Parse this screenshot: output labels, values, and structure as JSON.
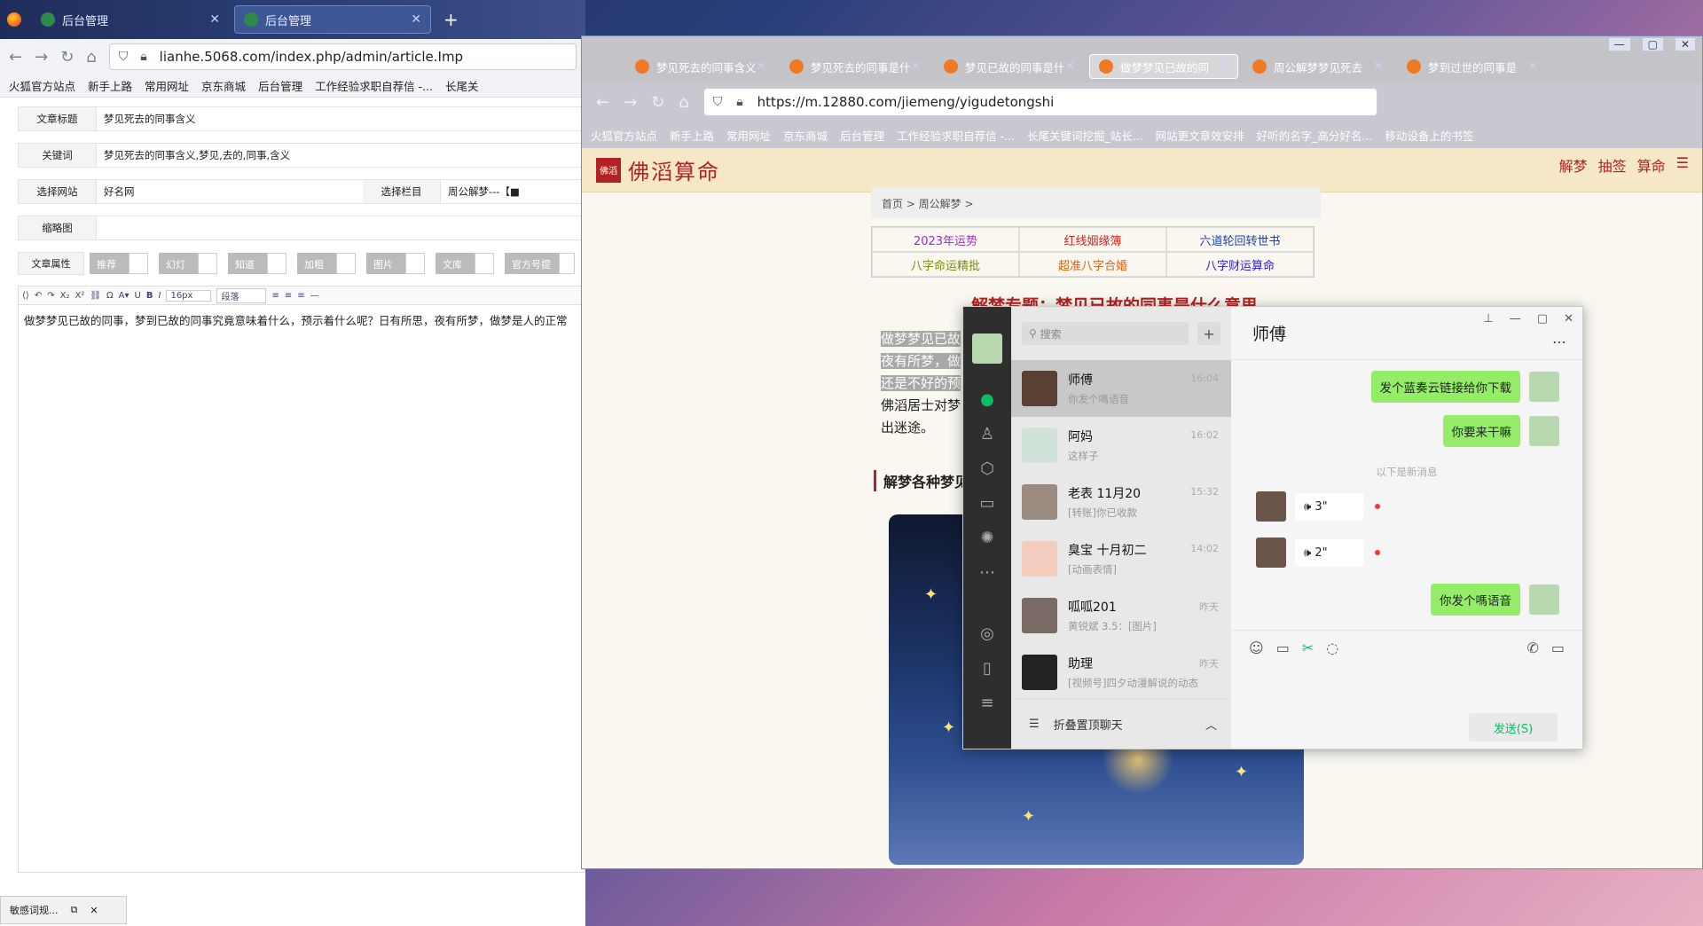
{
  "left_browser": {
    "tabs": [
      {
        "label": "后台管理",
        "close": "✕"
      },
      {
        "label": "后台管理",
        "close": "✕"
      }
    ],
    "new_tab": "+",
    "url": "lianhe.5068.com/index.php/admin/article.Imp",
    "bookmarks": [
      "火狐官方站点",
      "新手上路",
      "常用网址",
      "京东商城",
      "后台管理",
      "工作经验求职自荐信 -...",
      "长尾关"
    ],
    "form": {
      "title_label": "文章标题",
      "title_value": "梦见死去的同事含义",
      "keywords_label": "关键词",
      "keywords_value": "梦见死去的同事含义,梦见,去的,同事,含义",
      "site_label": "选择网站",
      "site_value": "好名网",
      "column_label": "选择栏目",
      "column_value": "周公解梦---【■",
      "thumb_label": "缩略图",
      "attr_label": "文章属性",
      "attrs": [
        "推荐",
        "幻灯",
        "知道",
        "加粗",
        "图片",
        "文库",
        "官方号提交"
      ]
    },
    "editor": {
      "font_size": "16px",
      "paragraph": "段落",
      "body": "做梦梦见已故的同事，梦到已故的同事究竟意味着什么，预示着什么呢？日有所思，夜有所梦，做梦是人的正常"
    },
    "notification": "敏感词规..."
  },
  "right_browser": {
    "tabs": [
      {
        "label": "梦见死去的同事含义"
      },
      {
        "label": "梦见死去的同事是什"
      },
      {
        "label": "梦见已故的同事是什"
      },
      {
        "label": "做梦梦见已故的同"
      },
      {
        "label": "周公解梦梦见死去"
      },
      {
        "label": "梦到过世的同事是"
      }
    ],
    "url": "https://m.12880.com/jiemeng/yigudetongshi",
    "bookmarks": [
      "火狐官方站点",
      "新手上路",
      "常用网址",
      "京东商城",
      "后台管理",
      "工作经验求职自荐信 -...",
      "长尾关键词挖掘_站长...",
      "网站更文章效安排",
      "好听的名字_高分好名...",
      "移动设备上的书签"
    ],
    "site": {
      "logo_text": "佛滔算命",
      "logo_mark": "佛滔",
      "nav": [
        "解梦",
        "抽签",
        "算命"
      ],
      "breadcrumb": "首页 > 周公解梦 >",
      "grid": [
        {
          "text": "2023年运势",
          "color": "#9b30c8"
        },
        {
          "text": "红线姻缘簿",
          "color": "#d92020"
        },
        {
          "text": "六道轮回转世书",
          "color": "#2040b0"
        },
        {
          "text": "八字命运精批",
          "color": "#7b8c00"
        },
        {
          "text": "超准八字合婚",
          "color": "#e06010"
        },
        {
          "text": "八字财运算命",
          "color": "#2a1ad0"
        }
      ],
      "article_title": "解梦专题：梦见已故的同事是什么意思",
      "article_lines": [
        "做梦梦见已故",
        "夜有所梦，做",
        "还是不好的预",
        "佛滔居士对梦",
        "出迷途。"
      ],
      "section": "解梦各种梦见"
    }
  },
  "wechat": {
    "search_placeholder": "搜索",
    "plus": "+",
    "chats": [
      {
        "name": "师傅",
        "msg": "你发个嗎语音",
        "time": "16:04"
      },
      {
        "name": "阿妈",
        "msg": "这样子",
        "time": "16:02"
      },
      {
        "name": "老表  11月20",
        "msg": "[转账]你已收款",
        "time": "15:32"
      },
      {
        "name": "臭宝    十月初二",
        "msg": "[动画表情]",
        "time": "14:02"
      },
      {
        "name": "呱呱201",
        "msg": "黄锐斌  3.5：[图片]",
        "time": "昨天"
      },
      {
        "name": "助理",
        "msg": "[视频号]四夕动漫解说的动态",
        "time": "昨天"
      }
    ],
    "fold_label": "折叠置顶聊天",
    "chat_title": "师傅",
    "messages": [
      {
        "side": "right",
        "text": "发个蓝奏云链接给你下载"
      },
      {
        "side": "right",
        "text": "你要来干嘛"
      },
      {
        "side": "left",
        "text": "3\""
      },
      {
        "side": "left",
        "text": "2\""
      },
      {
        "side": "right",
        "text": "你发个嗎语音"
      }
    ],
    "new_msg_divider": "以下是新消息",
    "send_label": "发送(S)"
  }
}
